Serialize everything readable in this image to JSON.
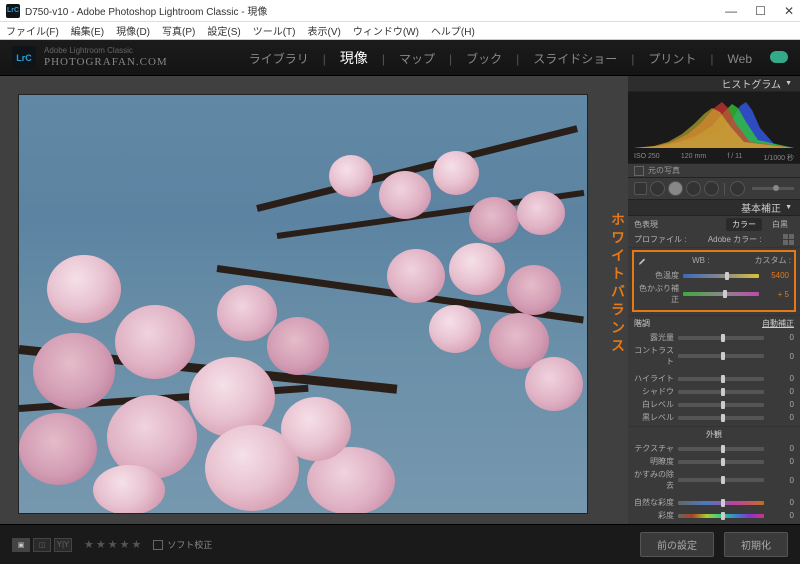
{
  "window": {
    "title": "D750-v10 - Adobe Photoshop Lightroom Classic - 現像",
    "app_icon": "LrC"
  },
  "menubar": [
    "ファイル(F)",
    "編集(E)",
    "現像(D)",
    "写真(P)",
    "設定(S)",
    "ツール(T)",
    "表示(V)",
    "ウィンドウ(W)",
    "ヘルプ(H)"
  ],
  "brand": {
    "top": "Adobe Lightroom Classic",
    "main": "PHOTOGRAFAN.COM",
    "badge": "LrC"
  },
  "modules": {
    "items": [
      "ライブラリ",
      "現像",
      "マップ",
      "ブック",
      "スライドショー",
      "プリント",
      "Web"
    ],
    "active": "現像"
  },
  "histogram": {
    "title": "ヒストグラム",
    "info": [
      "ISO 250",
      "120 mm",
      "f / 11",
      "1/1000 秒"
    ],
    "original": "元の写真"
  },
  "basic_panel": {
    "title": "基本補正",
    "treatment": {
      "label": "色表現",
      "options": [
        "カラー",
        "白黒"
      ],
      "selected": "カラー"
    },
    "profile": {
      "label": "プロファイル :",
      "value": "Adobe カラー",
      "suffix": ":"
    },
    "wb": {
      "label": "WB :",
      "mode": "カスタム",
      "mode_suffix": ":",
      "sliders": [
        {
          "name": "temperature",
          "label": "色温度",
          "value": "5400",
          "pos": 55
        },
        {
          "name": "tint",
          "label": "色かぶり補正",
          "value": "+ 5",
          "pos": 52
        }
      ]
    },
    "tone": {
      "header": "階調",
      "auto": "自動補正",
      "sliders": [
        {
          "name": "exposure",
          "label": "露光量",
          "value": "0",
          "pos": 50
        },
        {
          "name": "contrast",
          "label": "コントラスト",
          "value": "0",
          "pos": 50
        },
        {
          "name": "highlights",
          "label": "ハイライト",
          "value": "0",
          "pos": 50
        },
        {
          "name": "shadows",
          "label": "シャドウ",
          "value": "0",
          "pos": 50
        },
        {
          "name": "whites",
          "label": "白レベル",
          "value": "0",
          "pos": 50
        },
        {
          "name": "blacks",
          "label": "黒レベル",
          "value": "0",
          "pos": 50
        }
      ]
    },
    "presence": {
      "header": "外観",
      "sliders": [
        {
          "name": "texture",
          "label": "テクスチャ",
          "value": "0",
          "pos": 50
        },
        {
          "name": "clarity",
          "label": "明瞭度",
          "value": "0",
          "pos": 50
        },
        {
          "name": "dehaze",
          "label": "かすみの除去",
          "value": "0",
          "pos": 50
        },
        {
          "name": "vibrance",
          "label": "自然な彩度",
          "value": "0",
          "pos": 50,
          "track": "vib"
        },
        {
          "name": "saturation",
          "label": "彩度",
          "value": "0",
          "pos": 50,
          "track": "sat"
        }
      ]
    }
  },
  "bottom": {
    "soft_proof": "ソフト校正",
    "previous": "前の設定",
    "reset": "初期化"
  },
  "annotation": "ホワイトバランス"
}
